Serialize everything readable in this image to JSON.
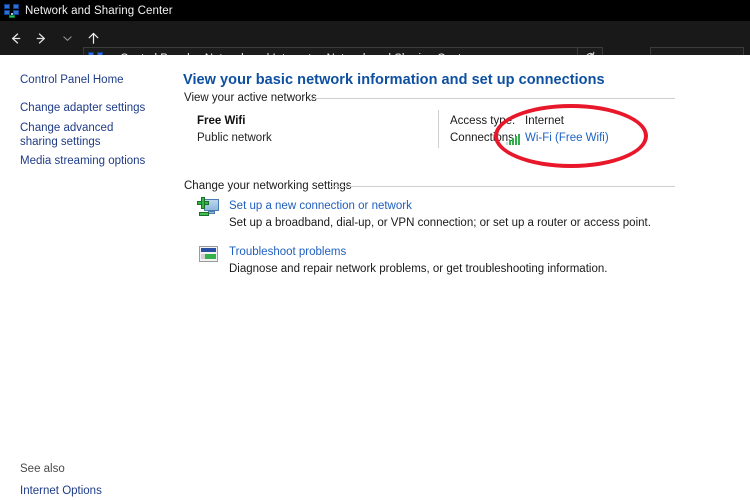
{
  "window": {
    "title": "Network and Sharing Center",
    "icon": "network-computers-icon"
  },
  "navbar": {
    "back_icon": "back-arrow-icon",
    "forward_icon": "forward-arrow-icon",
    "history_icon": "chevron-down-icon",
    "up_icon": "up-arrow-icon",
    "address_icon": "network-computers-icon",
    "breadcrumbs": [
      "Control Panel",
      "Network and Internet",
      "Network and Sharing Center"
    ],
    "separator": "›",
    "dropdown_icon": "chevron-down-icon",
    "refresh_icon": "refresh-icon",
    "search": {
      "value": "",
      "placeholder": ""
    }
  },
  "sidebar": {
    "items": [
      {
        "label": "Control Panel Home"
      },
      {
        "label": "Change adapter settings"
      },
      {
        "label": "Change advanced sharing settings"
      },
      {
        "label": "Media streaming options"
      }
    ],
    "see_also": {
      "heading": "See also",
      "items": [
        {
          "label": "Internet Options"
        }
      ]
    }
  },
  "main": {
    "heading": "View your basic network information and set up connections",
    "active_networks": {
      "section_title": "View your active networks",
      "network": {
        "name": "Free Wifi",
        "type": "Public network"
      },
      "details": [
        {
          "label": "Access type:",
          "value": "Internet",
          "is_link": false,
          "icon": ""
        },
        {
          "label": "Connections:",
          "value": "Wi-Fi (Free Wifi)",
          "is_link": true,
          "icon": "wifi-signal-icon"
        }
      ]
    },
    "networking_settings": {
      "section_title": "Change your networking settings",
      "tasks": [
        {
          "icon": "setup-connection-icon",
          "link": "Set up a new connection or network",
          "description": "Set up a broadband, dial-up, or VPN connection; or set up a router or access point."
        },
        {
          "icon": "troubleshoot-icon",
          "link": "Troubleshoot problems",
          "description": "Diagnose and repair network problems, or get troubleshooting information."
        }
      ]
    }
  },
  "annotations": [
    {
      "type": "ellipse",
      "color": "#e8172a",
      "target": "connection-details-highlight"
    }
  ],
  "colors": {
    "titlebar_bg": "#000000",
    "navbar_bg": "#191919",
    "link": "#1f5fbf",
    "heading": "#0d4fa0",
    "annotation": "#e8172a",
    "signal_green": "#2fae4a"
  }
}
